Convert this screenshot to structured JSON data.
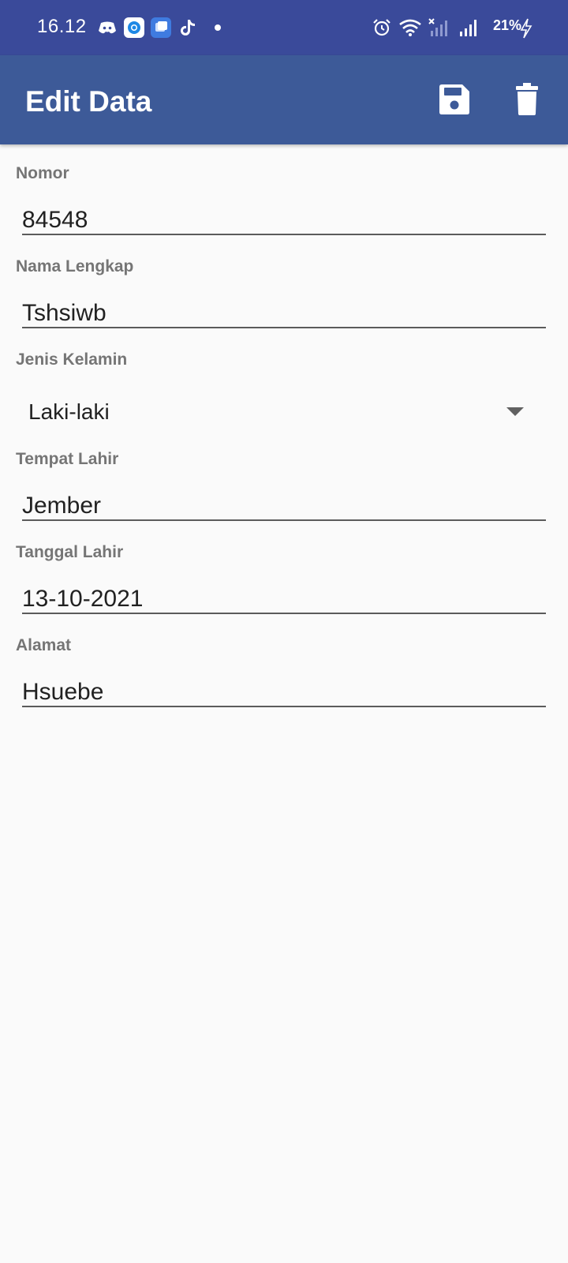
{
  "status_bar": {
    "time": "16.12",
    "battery": "21%",
    "left_icons": [
      "discord-icon",
      "chrome-icon",
      "multiwindow-icon",
      "tiktok-icon",
      "dot-icon"
    ],
    "right_icons": [
      "alarm-icon",
      "wifi-icon",
      "signal-x-icon",
      "signal-icon",
      "charging-icon"
    ]
  },
  "app_bar": {
    "title": "Edit Data",
    "actions": [
      "save-icon",
      "delete-icon"
    ]
  },
  "form": {
    "nomor": {
      "label": "Nomor",
      "value": "84548"
    },
    "nama": {
      "label": "Nama Lengkap",
      "value": "Tshsiwb"
    },
    "jenis_kelamin": {
      "label": "Jenis Kelamin",
      "value": "Laki-laki"
    },
    "tempat_lahir": {
      "label": "Tempat Lahir",
      "value": "Jember"
    },
    "tanggal_lahir": {
      "label": "Tanggal Lahir",
      "value": "13-10-2021"
    },
    "alamat": {
      "label": "Alamat",
      "value": "Hsuebe"
    }
  },
  "colors": {
    "status_bar": "#3a4a9a",
    "app_bar": "#3d5a98",
    "background": "#fafafa",
    "label": "#757575",
    "text": "#212121"
  }
}
